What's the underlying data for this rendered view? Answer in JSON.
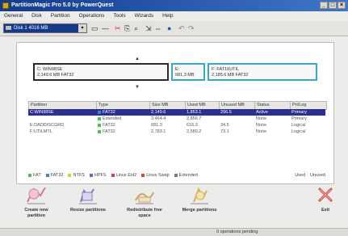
{
  "window": {
    "title": "PartitionMagic Pro 5.0 by PowerQuest"
  },
  "menu": [
    "General",
    "Disk",
    "Partition",
    "Operations",
    "Tools",
    "Wizards",
    "Help"
  ],
  "toolbar": {
    "drive": "Disk 1  4016 MB"
  },
  "diskmap": {
    "p1": {
      "line1": "C:  WIN98SE",
      "line2": "2,149.6 MB   FAT32"
    },
    "p2": {
      "line1": "E:",
      "line2": "681.3 MB"
    },
    "p3": {
      "line1": "F:  FAT16UTIL",
      "line2": "2,185.6 MB   FAT32"
    }
  },
  "table": {
    "headers": [
      "Partition",
      "Type",
      "Size MB",
      "Used MB",
      "Unused MB",
      "Status",
      "Pri/Log"
    ],
    "rows": [
      {
        "partition": "C:WIN98SE",
        "type": "FAT32",
        "size": "2,149.6",
        "used": "1,853.1",
        "unused": "296.5",
        "status": "Active",
        "pri": "Primary",
        "color": "#2f8fd0",
        "selected": true
      },
      {
        "partition": "",
        "type": "Extended",
        "size": "3,464.4",
        "used": "2,856.7",
        "unused": "",
        "status": "None",
        "pri": "Primary",
        "color": "#49c060",
        "selected": false
      },
      {
        "partition": "E:DADDISCGRD",
        "type": "FAT32",
        "size": "681.3",
        "used": "616.3",
        "unused": "34.5",
        "status": "None",
        "pri": "Logical",
        "color": "#49c060",
        "selected": false
      },
      {
        "partition": "F:UTILMTL",
        "type": "FAT32",
        "size": "2,783.1",
        "used": "2,580.2",
        "unused": "73.1",
        "status": "None",
        "pri": "Logical",
        "color": "#49c060",
        "selected": false
      }
    ]
  },
  "legend": [
    {
      "label": "FAT",
      "color": "#49c060"
    },
    {
      "label": "FAT32",
      "color": "#2f8fd0"
    },
    {
      "label": "NTFS",
      "color": "#d7d030"
    },
    {
      "label": "HPFS",
      "color": "#7a58c8"
    },
    {
      "label": "Linux Ext2",
      "color": "#d03a7a"
    },
    {
      "label": "Linux Swap",
      "color": "#d84a2a"
    },
    {
      "label": "Extended",
      "color": "#7a7a7a"
    }
  ],
  "legend_buttons": {
    "used": "Used",
    "unused": "Unused"
  },
  "actions": [
    {
      "id": "create",
      "label": "Create new partition",
      "color": "#d77aa0"
    },
    {
      "id": "resize",
      "label": "Resize partitions",
      "color": "#8a7ab8"
    },
    {
      "id": "redistribute",
      "label": "Redistribute free space",
      "color": "#c8a86a"
    },
    {
      "id": "merge",
      "label": "Merge partitions",
      "color": "#d4b45a"
    },
    {
      "id": "exit",
      "label": "Exit",
      "color": "#d0463a"
    }
  ],
  "status": {
    "text": "0 operations pending"
  }
}
